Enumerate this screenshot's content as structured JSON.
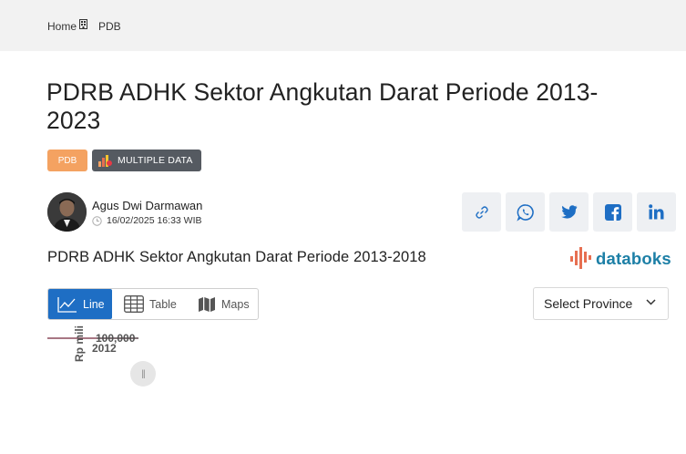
{
  "breadcrumb": {
    "home": "Home",
    "current": "PDB"
  },
  "page": {
    "title": "PDRB ADHK Sektor Angkutan Darat Periode 2013-2023"
  },
  "tags": {
    "category": "PDB",
    "multiple": "MULTIPLE DATA"
  },
  "author": {
    "name": "Agus Dwi Darmawan",
    "datetime": "16/02/2025 16:33 WIB"
  },
  "share": {
    "icons": [
      "link-icon",
      "whatsapp-icon",
      "twitter-icon",
      "facebook-icon",
      "linkedin-icon"
    ]
  },
  "chart_section": {
    "title": "PDRB ADHK Sektor Angkutan Darat Periode 2013-2018",
    "logo": "databoks",
    "tabs": [
      {
        "label": "Line",
        "icon": "line-chart-icon",
        "active": true
      },
      {
        "label": "Table",
        "icon": "table-icon",
        "active": false
      },
      {
        "label": "Maps",
        "icon": "map-icon",
        "active": false
      }
    ],
    "province_select": "Select Province",
    "handle_glyph": "||"
  },
  "colors": {
    "accent": "#1e6ec4",
    "tag_pdb": "#f4a261",
    "tag_multi": "#555a61",
    "series": "#8b4a5c",
    "logo": "#1c7fa6"
  },
  "chart_data": {
    "type": "line",
    "ylabel": "Rp mili",
    "yticks": [
      "100,000"
    ],
    "x": [
      "2012"
    ],
    "series": []
  }
}
